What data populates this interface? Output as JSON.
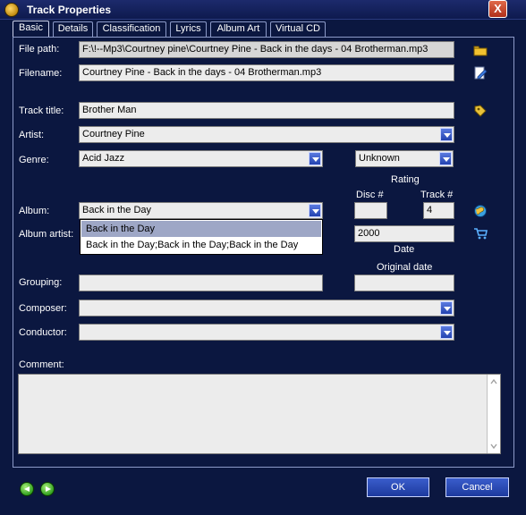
{
  "window": {
    "title": "Track Properties",
    "close_label": "X"
  },
  "tabs": [
    {
      "label": "Basic"
    },
    {
      "label": "Details"
    },
    {
      "label": "Classification"
    },
    {
      "label": "Lyrics"
    },
    {
      "label": "Album Art"
    },
    {
      "label": "Virtual CD"
    }
  ],
  "fields": {
    "file_path": {
      "label": "File path:",
      "value": "F:\\!--Mp3\\Courtney pine\\Courtney Pine - Back in the days - 04 Brotherman.mp3"
    },
    "filename": {
      "label": "Filename:",
      "value": "Courtney Pine - Back in the days - 04 Brotherman.mp3"
    },
    "track_title": {
      "label": "Track title:",
      "value": "Brother Man"
    },
    "artist": {
      "label": "Artist:",
      "value": "Courtney Pine"
    },
    "genre": {
      "label": "Genre:",
      "value": "Acid Jazz"
    },
    "rating": {
      "label": "Rating",
      "value": "Unknown"
    },
    "album": {
      "label": "Album:",
      "value": "Back in the Day"
    },
    "album_artist": {
      "label": "Album artist:",
      "value": ""
    },
    "disc": {
      "label": "Disc #",
      "value": ""
    },
    "track": {
      "label": "Track #",
      "value": "4"
    },
    "date": {
      "label": "Date",
      "value": "2000"
    },
    "original_date": {
      "label": "Original date",
      "value": ""
    },
    "grouping": {
      "label": "Grouping:",
      "value": ""
    },
    "composer": {
      "label": "Composer:",
      "value": ""
    },
    "conductor": {
      "label": "Conductor:",
      "value": ""
    },
    "comment": {
      "label": "Comment:",
      "value": ""
    }
  },
  "album_dropdown": {
    "options": [
      "Back in the Day",
      "Back in the Day;Back in the Day;Back in the Day"
    ],
    "highlighted_index": 0
  },
  "buttons": {
    "ok": "OK",
    "cancel": "Cancel"
  },
  "icons": {
    "browse": "folder-icon",
    "rename": "rename-file-icon",
    "tag_lookup": "tag-lookup-icon",
    "album_web": "globe-icon",
    "shop": "cart-icon",
    "prev": "prev-arrow-icon",
    "next": "next-arrow-icon"
  },
  "colors": {
    "background": "#0b1740",
    "field": "#ececec",
    "combo_button": "#2443b0",
    "dropdown_highlight": "#9ea7c6",
    "nav_button": "#32a020"
  }
}
